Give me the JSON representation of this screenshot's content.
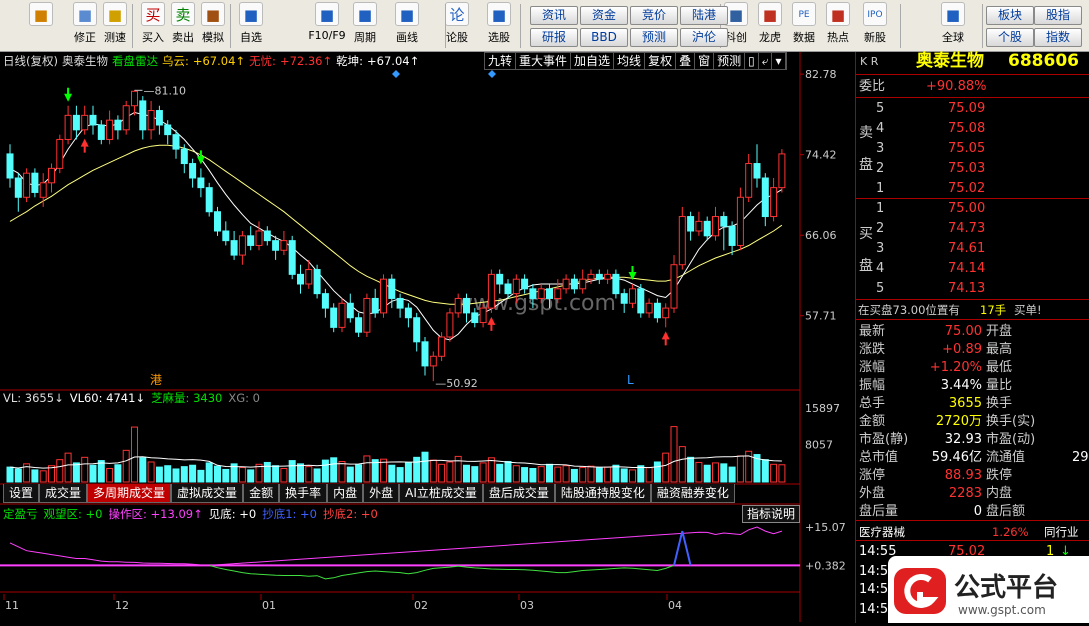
{
  "toolbar": {
    "buttons": [
      {
        "label": "",
        "icon": "back-arrow-icon"
      },
      {
        "label": "修正",
        "icon": "arrow-up-down-icon"
      },
      {
        "label": "测速",
        "icon": "clock-icon"
      },
      {
        "label": "买入",
        "icon": "buy-icon",
        "glyph": "买"
      },
      {
        "label": "卖出",
        "icon": "sell-icon",
        "glyph": "卖"
      },
      {
        "label": "模拟",
        "icon": "hammer-icon"
      },
      {
        "label": "自选",
        "icon": "star-folder-icon"
      },
      {
        "label": "F10/F9",
        "icon": "f10-window-icon"
      },
      {
        "label": "周期",
        "icon": "period-icon"
      },
      {
        "label": "画线",
        "icon": "pencil-icon"
      },
      {
        "label": "论股",
        "icon": "discuss-icon",
        "glyph": "论"
      },
      {
        "label": "选股",
        "icon": "radar-icon"
      },
      {
        "label": "科创",
        "icon": "chart-icon"
      },
      {
        "label": "龙虎",
        "icon": "tiger-icon"
      },
      {
        "label": "数据",
        "icon": "pe-icon",
        "glyph": "PE"
      },
      {
        "label": "热点",
        "icon": "fire-icon"
      },
      {
        "label": "新股",
        "icon": "ipo-icon",
        "glyph": "IPO"
      },
      {
        "label": "全球",
        "icon": "globe-icon"
      }
    ],
    "small_buttons": [
      "资讯",
      "资金",
      "竞价",
      "陆港",
      "研报",
      "BBD",
      "预测",
      "沪伦",
      "板块",
      "股指",
      "个股",
      "指数"
    ]
  },
  "chart": {
    "info": [
      {
        "t": "日线(复权)",
        "c": "#dddddd"
      },
      {
        "t": "奥泰生物",
        "c": "#dddddd"
      },
      {
        "t": "看盘雷达",
        "c": "#00e000"
      },
      {
        "t": "乌云:",
        "c": "#ffd000"
      },
      {
        "t": "+67.04↑",
        "c": "#ffd000"
      },
      {
        "t": "无忧:",
        "c": "#ff3030"
      },
      {
        "t": "+72.36↑",
        "c": "#ff3030"
      },
      {
        "t": "乾坤:",
        "c": "#ffffff"
      },
      {
        "t": "+67.04↑",
        "c": "#ffffff"
      }
    ],
    "tabs": [
      "九转",
      "重大事件",
      "加自选",
      "均线",
      "复权",
      "叠",
      "窗",
      "预测"
    ],
    "tab_icons": [
      "lock-icon",
      "back-icon",
      "dropdown-icon"
    ],
    "price_ticks": [
      "82.78",
      "74.42",
      "66.06",
      "57.71"
    ],
    "high_label": "81.10",
    "low_label": "50.92",
    "marker_gang": "港",
    "marker_L": "L",
    "watermark": "www.gspt.com",
    "vol_info": [
      {
        "t": "VL: 3655↓",
        "c": "#dddddd"
      },
      {
        "t": "VL60: 4741↓",
        "c": "#ffffff"
      },
      {
        "t": "芝麻量: 3430",
        "c": "#00e000"
      },
      {
        "t": "XG: 0",
        "c": "#888888"
      }
    ],
    "vol_ticks": [
      "15897",
      "8057"
    ],
    "subtabs": [
      "设置",
      "成交量",
      "多周期成交量",
      "虚拟成交量",
      "金额",
      "换手率",
      "内盘",
      "外盘",
      "AI立桩成交量",
      "盘后成交量",
      "陆股通持股变化",
      "融资融券变化"
    ],
    "ind_info": [
      {
        "t": "定盈亏",
        "c": "#00e000"
      },
      {
        "t": "观望区: +0",
        "c": "#00e000"
      },
      {
        "t": "操作区: +13.09↑",
        "c": "#ff40ff"
      },
      {
        "t": "见底: +0",
        "c": "#ffffff"
      },
      {
        "t": "抄底1: +0",
        "c": "#4060ff"
      },
      {
        "t": "抄底2: +0",
        "c": "#ff4040"
      }
    ],
    "ind_help": "指标说明",
    "ind_ticks": [
      "+15.07",
      "+0.382"
    ],
    "months": [
      "11",
      "12",
      "01",
      "02",
      "03",
      "04"
    ]
  },
  "chart_data": {
    "type": "candlestick",
    "title": "",
    "period": "日线(复权)",
    "ylim": [
      50,
      83
    ],
    "candles": [
      [
        74.5,
        72.0,
        75.5,
        71.0
      ],
      [
        72.0,
        70.0,
        72.5,
        68.5
      ],
      [
        70.0,
        72.5,
        73.0,
        69.5
      ],
      [
        72.5,
        70.5,
        73.0,
        70.0
      ],
      [
        70.0,
        71.5,
        72.5,
        69.0
      ],
      [
        71.5,
        73.0,
        73.5,
        70.5
      ],
      [
        73.0,
        76.0,
        76.5,
        72.5
      ],
      [
        76.0,
        78.5,
        79.5,
        75.5
      ],
      [
        78.5,
        77.0,
        79.5,
        76.0
      ],
      [
        77.0,
        78.5,
        79.5,
        76.5
      ],
      [
        78.5,
        77.5,
        79.5,
        76.5
      ],
      [
        77.5,
        76.0,
        78.0,
        75.5
      ],
      [
        76.0,
        78.0,
        79.0,
        75.5
      ],
      [
        78.0,
        77.0,
        78.5,
        76.0
      ],
      [
        77.0,
        79.5,
        80.0,
        76.5
      ],
      [
        79.5,
        81.0,
        81.1,
        78.5
      ],
      [
        80.0,
        77.0,
        80.5,
        76.0
      ],
      [
        77.0,
        79.0,
        80.0,
        76.0
      ],
      [
        79.0,
        77.5,
        79.5,
        76.5
      ],
      [
        77.5,
        76.5,
        78.0,
        75.5
      ],
      [
        76.5,
        75.0,
        77.0,
        74.0
      ],
      [
        75.0,
        73.5,
        75.5,
        72.5
      ],
      [
        73.5,
        72.0,
        74.0,
        71.0
      ],
      [
        72.0,
        71.0,
        73.0,
        70.0
      ],
      [
        71.0,
        68.5,
        71.5,
        68.0
      ],
      [
        68.5,
        66.5,
        69.0,
        66.0
      ],
      [
        66.5,
        65.5,
        67.5,
        65.0
      ],
      [
        65.5,
        64.0,
        66.5,
        63.5
      ],
      [
        64.0,
        66.0,
        66.5,
        63.0
      ],
      [
        66.0,
        65.0,
        67.0,
        64.5
      ],
      [
        65.0,
        66.5,
        67.5,
        64.5
      ],
      [
        66.5,
        65.5,
        67.0,
        65.0
      ],
      [
        65.5,
        64.5,
        66.0,
        63.5
      ],
      [
        64.5,
        65.5,
        66.5,
        64.0
      ],
      [
        65.5,
        62.0,
        66.0,
        61.5
      ],
      [
        62.0,
        61.0,
        63.0,
        60.0
      ],
      [
        61.0,
        62.5,
        63.5,
        60.5
      ],
      [
        62.5,
        60.0,
        63.0,
        59.5
      ],
      [
        60.0,
        58.5,
        60.5,
        57.5
      ],
      [
        58.5,
        56.5,
        59.0,
        56.0
      ],
      [
        56.5,
        59.0,
        59.5,
        56.0
      ],
      [
        59.0,
        57.5,
        60.0,
        57.0
      ],
      [
        57.5,
        56.0,
        58.0,
        55.5
      ],
      [
        56.0,
        59.5,
        60.0,
        55.5
      ],
      [
        59.5,
        58.0,
        60.5,
        57.5
      ],
      [
        58.0,
        61.5,
        62.0,
        57.5
      ],
      [
        61.5,
        59.5,
        62.0,
        58.5
      ],
      [
        59.5,
        58.5,
        60.0,
        57.5
      ],
      [
        58.5,
        57.5,
        59.0,
        56.5
      ],
      [
        57.5,
        55.0,
        58.0,
        54.0
      ],
      [
        55.0,
        52.5,
        55.5,
        51.5
      ],
      [
        52.5,
        53.5,
        54.0,
        50.92
      ],
      [
        53.5,
        55.5,
        56.0,
        53.0
      ],
      [
        55.5,
        58.0,
        58.5,
        55.0
      ],
      [
        58.0,
        59.5,
        60.0,
        57.5
      ],
      [
        59.5,
        58.0,
        60.0,
        57.0
      ],
      [
        58.0,
        57.0,
        58.5,
        56.5
      ],
      [
        57.0,
        58.5,
        59.0,
        56.5
      ],
      [
        58.5,
        62.0,
        62.5,
        58.0
      ],
      [
        62.0,
        61.0,
        62.5,
        60.0
      ],
      [
        61.0,
        60.0,
        61.5,
        59.5
      ],
      [
        60.0,
        61.5,
        62.0,
        59.0
      ],
      [
        61.5,
        60.5,
        62.0,
        60.0
      ],
      [
        60.5,
        59.5,
        61.0,
        58.5
      ],
      [
        59.5,
        60.5,
        61.0,
        59.0
      ],
      [
        60.5,
        59.5,
        61.0,
        58.5
      ],
      [
        59.5,
        60.5,
        61.5,
        59.0
      ],
      [
        60.5,
        61.5,
        62.0,
        60.0
      ],
      [
        61.5,
        60.5,
        62.0,
        60.0
      ],
      [
        60.5,
        61.5,
        62.5,
        60.0
      ],
      [
        61.5,
        62.0,
        62.5,
        61.0
      ],
      [
        62.0,
        61.5,
        62.5,
        61.0
      ],
      [
        61.5,
        62.0,
        62.5,
        61.0
      ],
      [
        62.0,
        60.0,
        62.5,
        59.5
      ],
      [
        60.0,
        59.0,
        60.5,
        58.0
      ],
      [
        59.0,
        60.5,
        61.0,
        58.5
      ],
      [
        60.5,
        58.0,
        61.0,
        57.5
      ],
      [
        58.0,
        59.0,
        59.5,
        57.5
      ],
      [
        59.0,
        57.5,
        59.5,
        57.0
      ],
      [
        57.5,
        58.5,
        59.0,
        56.5
      ],
      [
        58.5,
        63.0,
        64.0,
        58.0
      ],
      [
        63.0,
        68.0,
        69.0,
        62.5
      ],
      [
        68.0,
        66.5,
        68.5,
        65.5
      ],
      [
        66.5,
        67.5,
        68.5,
        66.0
      ],
      [
        67.5,
        66.0,
        68.0,
        65.5
      ],
      [
        66.0,
        68.0,
        69.0,
        65.5
      ],
      [
        68.0,
        67.0,
        68.5,
        64.5
      ],
      [
        67.0,
        65.0,
        67.5,
        64.0
      ],
      [
        65.0,
        70.0,
        71.0,
        64.5
      ],
      [
        70.0,
        73.5,
        74.5,
        69.5
      ],
      [
        73.5,
        72.0,
        75.5,
        71.0
      ],
      [
        72.0,
        68.0,
        72.5,
        67.0
      ],
      [
        68.0,
        71.0,
        72.0,
        67.5
      ],
      [
        71.0,
        74.5,
        75.0,
        70.5
      ]
    ],
    "ma_short": [
      73,
      72.5,
      71.5,
      71.2,
      71.4,
      72.2,
      73.5,
      75,
      76.2,
      77.3,
      77.6,
      77.5,
      77.4,
      77.6,
      78.3,
      78.8,
      78.6,
      78.4,
      78,
      77.5,
      76.8,
      76,
      75,
      74,
      72.8,
      71.5,
      70.3,
      69.2,
      68.2,
      67.3,
      66.8,
      66.3,
      65.8,
      65.4,
      64.8,
      64,
      63.3,
      62.3,
      61.3,
      60.3,
      59.5,
      58.8,
      58.1,
      57.9,
      58,
      58.6,
      59.2,
      59.5,
      59.3,
      58.6,
      57.4,
      56.2,
      55.4,
      55.2,
      55.8,
      56.8,
      57.6,
      58,
      58.4,
      59,
      59.6,
      60.2,
      60.6,
      60.9,
      61,
      61,
      61,
      61,
      61,
      61.1,
      61.3,
      61.5,
      61.6,
      61.6,
      61.4,
      61,
      60.6,
      60.2,
      59.8,
      59.6,
      60.4,
      61.8,
      63.2,
      64.6,
      65.6,
      66.4,
      66.9,
      67,
      67.4,
      68.3,
      69.2,
      69.9,
      70.3,
      70.8
    ],
    "ma_long": [
      67.5,
      68,
      68.5,
      69.1,
      69.6,
      70.1,
      70.7,
      71.3,
      71.8,
      72.3,
      72.8,
      73.2,
      73.6,
      74,
      74.4,
      74.8,
      75.1,
      75.3,
      75.4,
      75.4,
      75.3,
      75.1,
      74.8,
      74.4,
      73.9,
      73.3,
      72.7,
      72.1,
      71.5,
      70.9,
      70.3,
      69.7,
      69.1,
      68.5,
      67.8,
      67.1,
      66.4,
      65.7,
      65,
      64.3,
      63.6,
      62.9,
      62.3,
      61.8,
      61.4,
      61,
      60.6,
      60.2,
      59.9,
      59.6,
      59.3,
      59.1,
      59,
      58.9,
      58.9,
      58.9,
      59,
      59.1,
      59.2,
      59.3,
      59.5,
      59.7,
      59.9,
      60.1,
      60.3,
      60.5,
      60.7,
      60.9,
      61.1,
      61.3,
      61.5,
      61.6,
      61.7,
      61.7,
      61.7,
      61.6,
      61.5,
      61.4,
      61.3,
      61.3,
      61.5,
      61.9,
      62.4,
      62.9,
      63.3,
      63.7,
      64,
      64.3,
      64.6,
      65,
      65.5,
      66,
      66.5,
      67.1
    ],
    "volume_ylim": [
      0,
      15897
    ],
    "volume": [
      3200,
      2800,
      3900,
      2600,
      2400,
      3500,
      4800,
      6200,
      4100,
      5300,
      3600,
      4600,
      2900,
      3700,
      6800,
      11800,
      5200,
      4300,
      3200,
      3500,
      2800,
      3300,
      3600,
      2500,
      4100,
      3400,
      2700,
      3900,
      3100,
      2600,
      3800,
      4200,
      3500,
      2900,
      4600,
      3900,
      3300,
      2800,
      4700,
      5200,
      4400,
      3200,
      3700,
      5600,
      4800,
      4900,
      3600,
      3100,
      4200,
      5300,
      6400,
      4700,
      3800,
      4300,
      5500,
      3600,
      3300,
      4100,
      5200,
      3800,
      4400,
      3500,
      3100,
      2900,
      3300,
      3800,
      3200,
      3500,
      2700,
      3100,
      3400,
      3000,
      3200,
      3600,
      2800,
      2600,
      3500,
      3100,
      4300,
      6200,
      11900,
      7600,
      5300,
      4200,
      3600,
      4100,
      3900,
      3200,
      5600,
      6600,
      5900,
      4800,
      3800,
      3700
    ],
    "indicator_ylim": [
      -6,
      17
    ],
    "indicator_pink": [
      9,
      7.5,
      6,
      5.5,
      5,
      4.5,
      4,
      3.5,
      3,
      3,
      2.5,
      2,
      1.8,
      1.8,
      1.6,
      1.5,
      1.3,
      1.2,
      1.2,
      1.1,
      1,
      1,
      0.8,
      0.5,
      0.38,
      null,
      null,
      null,
      null,
      null,
      null,
      null,
      null,
      null,
      null,
      null,
      null,
      null,
      null,
      null,
      null,
      null,
      null,
      null,
      null,
      null,
      null,
      null,
      null,
      null,
      null,
      null,
      null,
      null,
      null,
      null,
      null,
      null,
      null,
      null,
      null,
      null,
      null,
      null,
      null,
      null,
      null,
      null,
      null,
      null,
      null,
      null,
      null,
      null,
      null,
      null,
      null,
      null,
      null,
      null,
      null,
      null,
      null,
      13.09,
      13,
      12.2,
      12.8,
      12.5,
      12.2,
      14,
      15.07,
      13.5,
      12.5,
      13.5
    ],
    "indicator_green": [
      null,
      null,
      null,
      null,
      null,
      null,
      null,
      null,
      null,
      null,
      null,
      null,
      null,
      null,
      null,
      null,
      null,
      null,
      null,
      null,
      null,
      null,
      null,
      null,
      0.38,
      -0.5,
      -1.2,
      -1.8,
      -2.4,
      -2.8,
      -3,
      -3.2,
      -3.4,
      -3.5,
      -3.5,
      -3.5,
      -3.8,
      -3.6,
      -4.8,
      -4.4,
      -3.5,
      -3,
      -2.5,
      -2,
      -1.8,
      -2,
      -2.2,
      -2.4,
      -2.8,
      -2.4,
      -1.5,
      -0.8,
      -0.5,
      -0.3,
      0.1,
      -0.3,
      -0.6,
      -0.8,
      -1,
      -1.1,
      -1.2,
      -1.2,
      -1.3,
      -1.5,
      -1.8,
      -2.1,
      -2.4,
      -2.4,
      -2,
      -1.6,
      -1.4,
      -1.2,
      -1,
      -0.8,
      -0.6,
      -0.7,
      -1,
      -1.3,
      -1.6,
      -0.8,
      0.38,
      null,
      null,
      null,
      null,
      null,
      null,
      null,
      null,
      null,
      null,
      null,
      null,
      null
    ],
    "indicator_blue_spike": {
      "at": 81,
      "value": 13.5
    },
    "indicator_line": 0.382,
    "up_color": "#ff3232",
    "down_color": "#54fcfc",
    "ma_short_color": "#ffffff",
    "ma_long_color": "#ffff80"
  },
  "quote": {
    "code_letters": "K R",
    "name": "奥泰生物",
    "code": "688606",
    "weibi_label": "委比",
    "weibi": "+90.88%",
    "sell_label": [
      "卖",
      "盘"
    ],
    "buy_label": [
      "买",
      "盘"
    ],
    "sell": [
      [
        "5",
        "75.09"
      ],
      [
        "4",
        "75.08"
      ],
      [
        "3",
        "75.05"
      ],
      [
        "2",
        "75.03"
      ],
      [
        "1",
        "75.02"
      ]
    ],
    "buy": [
      [
        "1",
        "75.00"
      ],
      [
        "2",
        "74.73"
      ],
      [
        "3",
        "74.61"
      ],
      [
        "4",
        "74.14"
      ],
      [
        "5",
        "74.13"
      ]
    ],
    "zaimai": "在买盘73.00位置有",
    "zaimai_qty": "17手",
    "zaimai_action": "买单!",
    "stats": [
      [
        "最新",
        "75.00",
        "#ff3232",
        "开盘",
        ""
      ],
      [
        "涨跌",
        "+0.89",
        "#ff3232",
        "最高",
        ""
      ],
      [
        "涨幅",
        "+1.20%",
        "#ff3232",
        "最低",
        ""
      ],
      [
        "振幅",
        "3.44%",
        "#ffffff",
        "量比",
        ""
      ],
      [
        "总手",
        "3655",
        "#ffff00",
        "换手",
        ""
      ],
      [
        "金额",
        "2720万",
        "#ffff00",
        "换手(实)",
        ""
      ],
      [
        "市盈(静)",
        "32.93",
        "#ffffff",
        "市盈(动)",
        ""
      ],
      [
        "总市值",
        "59.46亿",
        "#ffffff",
        "流通值",
        "29"
      ],
      [
        "涨停",
        "88.93",
        "#ff3232",
        "跌停",
        ""
      ],
      [
        "外盘",
        "2283",
        "#ff3232",
        "内盘",
        ""
      ],
      [
        "盘后量",
        "0",
        "#ffffff",
        "盘后额",
        ""
      ]
    ],
    "sector": "医疗器械",
    "sector_pct": "1.26%",
    "sector_rank": "同行业",
    "ticks": [
      [
        "14:55",
        "75.02",
        "1"
      ],
      [
        "14:55",
        "75.00",
        "10"
      ]
    ],
    "ticks_partial": [
      "14:55",
      "14:55"
    ]
  },
  "logo": {
    "text": "公式平台",
    "url": "www.gspt.com"
  }
}
